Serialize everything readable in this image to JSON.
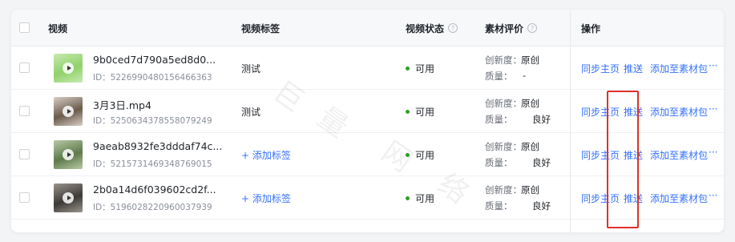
{
  "header": {
    "video": "视频",
    "tags": "视频标签",
    "status": "视频状态",
    "evaluation": "素材评价",
    "operations": "操作",
    "help_glyph": "?"
  },
  "rows": [
    {
      "name": "9b0ced7d790a5ed8d0...",
      "id": "ID：5226990480156466363",
      "tag": "测试",
      "tag_is_add": false,
      "status": "可用",
      "novelty_label": "创新度：",
      "novelty": "原创",
      "quality_label": "质量：",
      "quality": "-",
      "thumb_colors": [
        "#8fd16a",
        "#c7eab0"
      ]
    },
    {
      "name": "3月3日.mp4",
      "id": "ID：5250634378558079249",
      "tag": "测试",
      "tag_is_add": false,
      "status": "可用",
      "novelty_label": "创新度：",
      "novelty": "原创",
      "quality_label": "质量：",
      "quality": "良好",
      "thumb_colors": [
        "#6b5a4c",
        "#d9cfc6"
      ]
    },
    {
      "name": "9aeab8932fe3dddaf74c...",
      "id": "ID：5215731469348769015",
      "tag": "+ 添加标签",
      "tag_is_add": true,
      "status": "可用",
      "novelty_label": "创新度：",
      "novelty": "原创",
      "quality_label": "质量：",
      "quality": "良好",
      "thumb_colors": [
        "#5e7a4a",
        "#b8c9a6"
      ]
    },
    {
      "name": "2b0a14d6f039602cd2f...",
      "id": "ID：5196028220960037939",
      "tag": "+ 添加标签",
      "tag_is_add": true,
      "status": "可用",
      "novelty_label": "创新度：",
      "novelty": "原创",
      "quality_label": "质量：",
      "quality": "良好",
      "thumb_colors": [
        "#3d3a36",
        "#9a948c"
      ]
    }
  ],
  "operations": {
    "sync_home": "同步主页",
    "push": "推送",
    "add_to_pack": "添加至素材包",
    "more": "···"
  },
  "watermark": [
    "巨",
    "量",
    "网",
    "络"
  ],
  "colors": {
    "link": "#3370ff",
    "status_dot": "#2ea121",
    "highlight_box": "#e0312a"
  }
}
